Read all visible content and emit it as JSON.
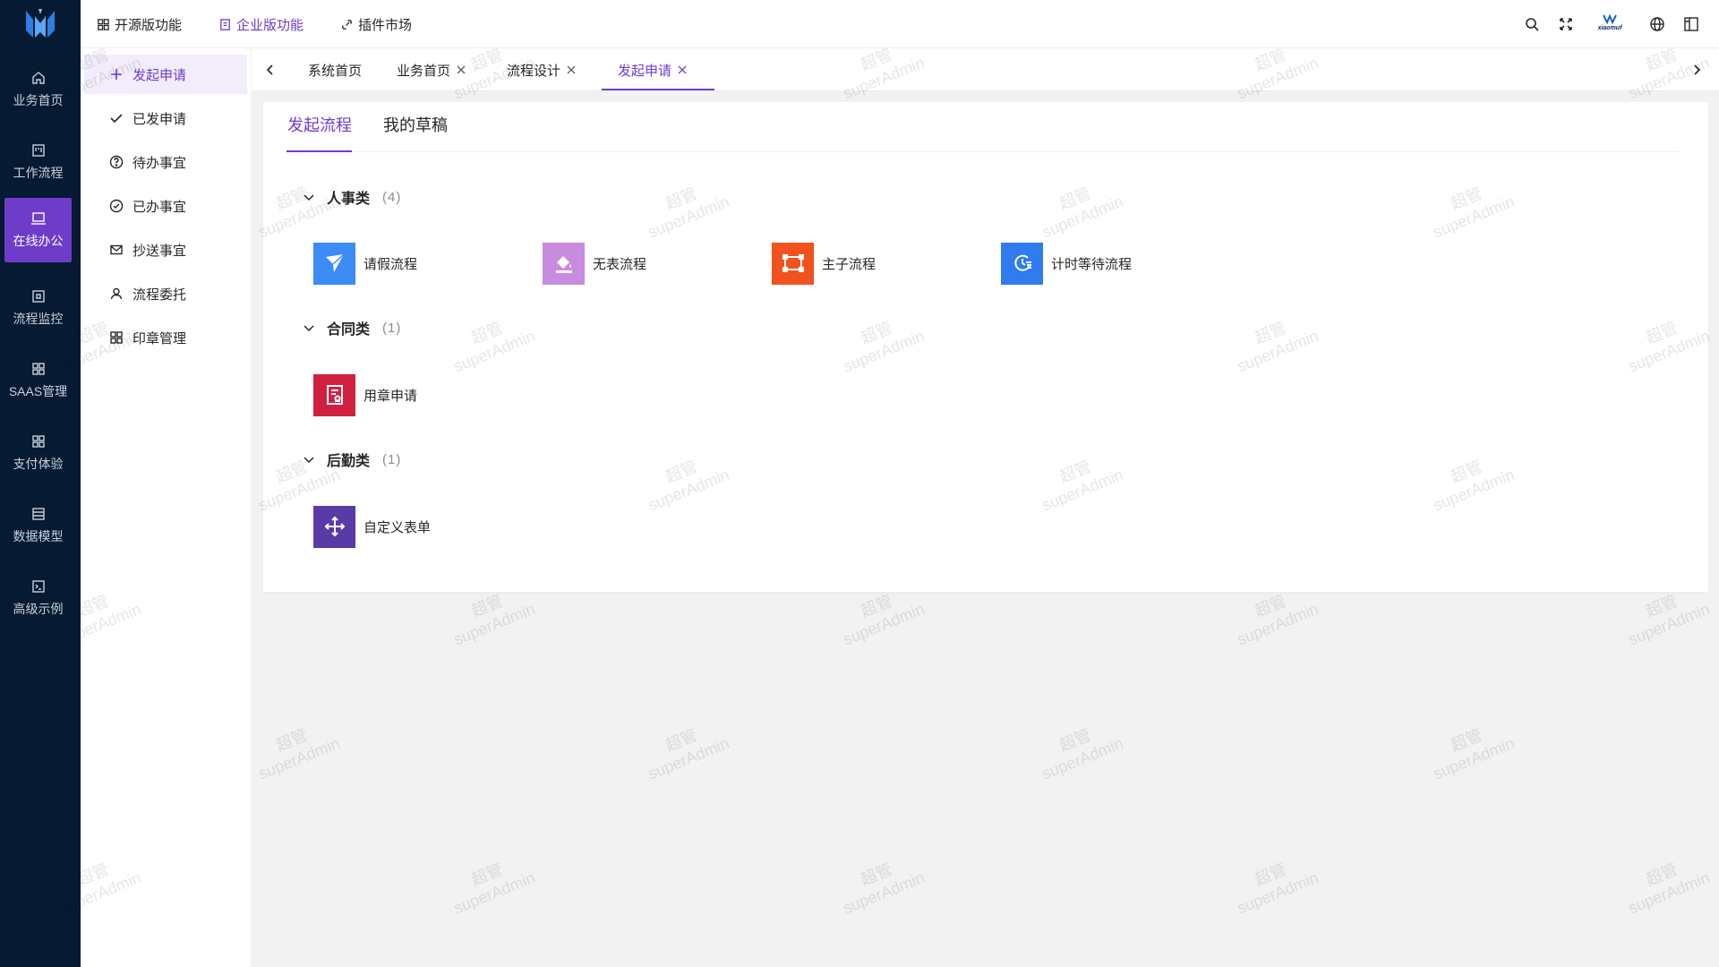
{
  "colors": {
    "rail_bg": "#061a33",
    "accent": "#6f3cc9",
    "page_bg": "#f2f2f2"
  },
  "rail": {
    "logo": "brand-logo",
    "items": [
      {
        "label": "业务首页",
        "icon": "home-icon",
        "active": false
      },
      {
        "label": "工作流程",
        "icon": "workflow-icon",
        "active": false
      },
      {
        "label": "在线办公",
        "icon": "office-icon",
        "active": true
      },
      {
        "label": "流程监控",
        "icon": "monitor-icon",
        "active": false
      },
      {
        "label": "SAAS管理",
        "icon": "grid-icon",
        "active": false
      },
      {
        "label": "支付体验",
        "icon": "grid-icon",
        "active": false
      },
      {
        "label": "数据模型",
        "icon": "model-icon",
        "active": false
      },
      {
        "label": "高级示例",
        "icon": "terminal-icon",
        "active": false
      }
    ]
  },
  "submenu": {
    "items": [
      {
        "label": "发起申请",
        "icon": "plus-icon",
        "active": true
      },
      {
        "label": "已发申请",
        "icon": "check-icon",
        "active": false
      },
      {
        "label": "待办事宜",
        "icon": "question-icon",
        "active": false
      },
      {
        "label": "已办事宜",
        "icon": "check-circle-icon",
        "active": false
      },
      {
        "label": "抄送事宜",
        "icon": "mail-icon",
        "active": false
      },
      {
        "label": "流程委托",
        "icon": "user-icon",
        "active": false
      },
      {
        "label": "印章管理",
        "icon": "grid-icon",
        "active": false
      }
    ]
  },
  "topbar": {
    "links": [
      {
        "label": "开源版功能",
        "icon": "grid-icon",
        "active": false
      },
      {
        "label": "企业版功能",
        "icon": "book-icon",
        "active": true
      },
      {
        "label": "插件市场",
        "icon": "link-icon",
        "active": false
      }
    ],
    "tools": [
      "search-icon",
      "fullscreen-icon",
      "user-avatar",
      "language-icon",
      "layout-icon"
    ],
    "avatar_text": "xiaomuf"
  },
  "tabs": {
    "items": [
      {
        "label": "系统首页",
        "closable": false,
        "active": false
      },
      {
        "label": "业务首页",
        "closable": true,
        "active": false
      },
      {
        "label": "流程设计",
        "closable": true,
        "active": false
      },
      {
        "label": "发起申请",
        "closable": true,
        "active": true
      }
    ]
  },
  "content": {
    "tabs": [
      {
        "label": "发起流程",
        "active": true
      },
      {
        "label": "我的草稿",
        "active": false
      }
    ],
    "groups": [
      {
        "name": "人事类",
        "count": "(4)",
        "flows": [
          {
            "label": "请假流程",
            "icon": "send-icon",
            "color": "#3b8cf5"
          },
          {
            "label": "无表流程",
            "icon": "paint-bucket-icon",
            "color": "#c88be0"
          },
          {
            "label": "主子流程",
            "icon": "frame-icon",
            "color": "#f2521e"
          },
          {
            "label": "计时等待流程",
            "icon": "timer-icon",
            "color": "#2f7bef"
          }
        ]
      },
      {
        "name": "合同类",
        "count": "(1)",
        "flows": [
          {
            "label": "用章申请",
            "icon": "stamp-icon",
            "color": "#d1203f"
          }
        ]
      },
      {
        "name": "后勤类",
        "count": "(1)",
        "flows": [
          {
            "label": "自定义表单",
            "icon": "move-icon",
            "color": "#5a3aa6"
          }
        ]
      }
    ]
  },
  "watermark": {
    "line1": "超管",
    "line2": "superAdmin"
  }
}
